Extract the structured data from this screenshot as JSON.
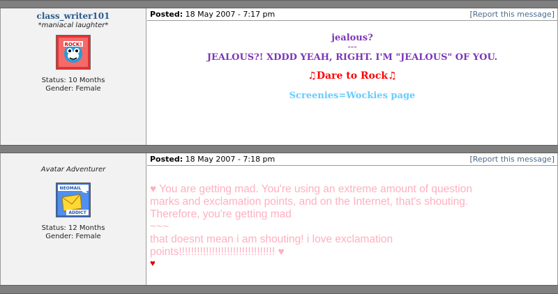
{
  "posts": [
    {
      "username": "class_writer101",
      "user_title": "*maniacal laughter*",
      "avatar_icon": "rock-avatar-icon",
      "status": "Status: 10 Months",
      "gender": "Gender: Female",
      "posted_label": "Posted:",
      "posted_date": "18 May 2007 - 7:17 pm",
      "report_open": "[",
      "report_link": "Report this message",
      "report_close": "]",
      "body": {
        "line1": "jealous?",
        "line2": "---",
        "line3": "JEALOUS?! XDDD YEAH, RIGHT. I'M \"JEALOUS\" OF YOU.",
        "signature": "♫Dare to Rock♫",
        "link": "Screenies=Wockies page"
      }
    },
    {
      "username": "",
      "user_title": "Avatar Adventurer",
      "avatar_icon": "neomail-addict-icon",
      "avatar_text_top": "NEOMAIL",
      "avatar_text_bottom": "ADDICT",
      "status": "Status: 12 Months",
      "gender": "Gender: Female",
      "posted_label": "Posted:",
      "posted_date": "18 May 2007 - 7:18 pm",
      "report_open": "[",
      "report_link": "Report this message",
      "report_close": "]",
      "body": {
        "line1": "♥ You are getting mad. You're using an extreme amount of question",
        "line2": "marks and exclamation points, and on the Internet, that's shouting.",
        "line3": "Therefore, you're getting mad",
        "line4": "~~~",
        "line5": "that doesnt mean i am shouting! i love exclamation",
        "line6": "points!!!!!!!!!!!!!!!!!!!!!!!!!!!!!!!! ♥",
        "line7": "♥"
      }
    }
  ],
  "colors": {
    "divider": "#808080",
    "user_panel": "#f2f2f2",
    "purple_text": "#7b36b8",
    "signature_red": "#ff0000",
    "link_blue": "#66ccff",
    "pink_text": "#ffb0bf"
  }
}
